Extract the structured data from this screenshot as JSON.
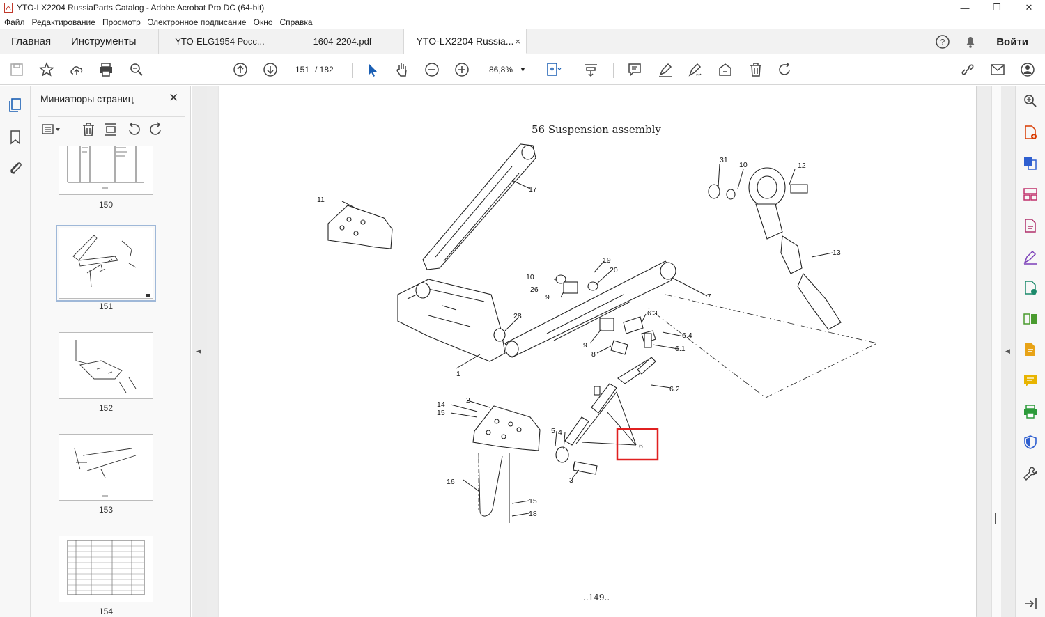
{
  "window": {
    "title": "YTO-LX2204 RussiaParts Catalog - Adobe Acrobat Pro DC (64-bit)",
    "controls": [
      "—",
      "❐",
      "✕"
    ]
  },
  "menu": [
    "Файл",
    "Редактирование",
    "Просмотр",
    "Электронное подписание",
    "Окно",
    "Справка"
  ],
  "tabs": {
    "home": "Главная",
    "tools": "Инструменты",
    "docs": [
      {
        "label": "YTO-ELG1954 Росс...",
        "active": false
      },
      {
        "label": "1604-2204.pdf",
        "active": false
      },
      {
        "label": "YTO-LX2204 Russia...",
        "active": true
      }
    ],
    "close": "×",
    "login": "Войти"
  },
  "toolbar": {
    "page_current": "151",
    "page_total": "/ 182",
    "zoom": "86,8%"
  },
  "thumbnails": {
    "title": "Миниатюры страниц",
    "close": "✕",
    "pages": [
      {
        "label": "150",
        "selected": false
      },
      {
        "label": "151",
        "selected": true
      },
      {
        "label": "152",
        "selected": false
      },
      {
        "label": "153",
        "selected": false
      },
      {
        "label": "154",
        "selected": false
      }
    ]
  },
  "page": {
    "title": "56 Suspension assembly",
    "page_number": "..149..",
    "callouts": [
      "1",
      "2",
      "3",
      "4",
      "5",
      "6",
      "6.1",
      "6.2",
      "6.3",
      "6.4",
      "7",
      "8",
      "8",
      "9",
      "9",
      "10",
      "10",
      "11",
      "12",
      "13",
      "14",
      "15",
      "15",
      "16",
      "17",
      "18",
      "19",
      "20",
      "26",
      "28",
      "31"
    ],
    "highlight_color": "#e02020"
  }
}
